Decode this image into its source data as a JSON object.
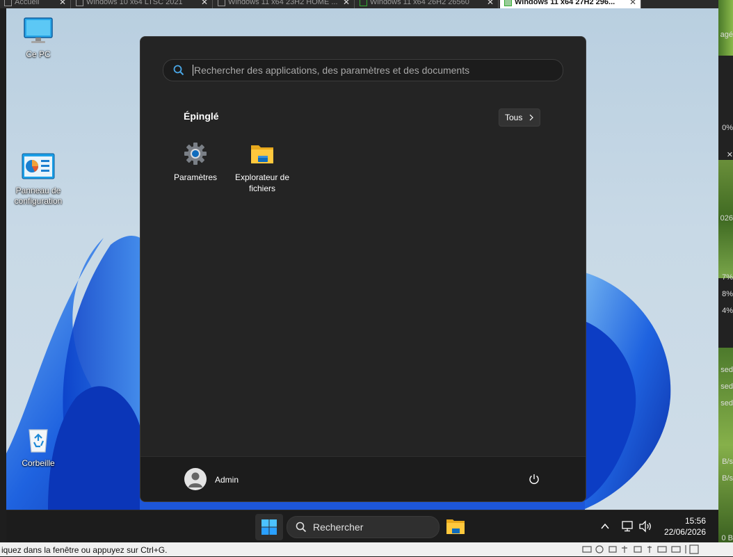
{
  "vm_tabs": [
    {
      "label": "Accueil"
    },
    {
      "label": "Windows 10 x64 LTSC 2021"
    },
    {
      "label": "Windows 11 x64 23H2 HOME ..."
    },
    {
      "label": "Windows 11 x64 26H2 26560"
    },
    {
      "label": "Windows 11 x64 27H2 296..."
    }
  ],
  "desktop": {
    "icons": [
      {
        "label": "Ce PC",
        "icon": "monitor-icon"
      },
      {
        "label": "Panneau de configuration",
        "icon": "control-panel-icon"
      },
      {
        "label": "Corbeille",
        "icon": "recycle-bin-icon"
      }
    ]
  },
  "start_menu": {
    "search_placeholder": "Rechercher des applications, des paramètres et des documents",
    "pinned_title": "Épinglé",
    "all_button": "Tous",
    "pinned_apps": [
      {
        "label": "Paramètres",
        "icon": "settings-gear-icon"
      },
      {
        "label": "Explorateur de fichiers",
        "icon": "folder-icon"
      }
    ],
    "user_name": "Admin",
    "power_icon": "power-icon"
  },
  "taskbar": {
    "search_label": "Rechercher",
    "time": "15:56",
    "date": "22/06/2026"
  },
  "host_statusbar": {
    "hint": "iquez dans la fenêtre ou appuyez sur Ctrl+G."
  },
  "right_panel": {
    "fragments": [
      "agé",
      "0%",
      "026",
      "7%",
      "8%",
      "4%",
      "sed",
      "sed",
      "sed",
      "B/s",
      "B/s",
      "0 B"
    ]
  },
  "colors": {
    "accent": "#0f6cbd",
    "menu_bg": "#242424",
    "taskbar_bg": "#1c1c1c"
  }
}
